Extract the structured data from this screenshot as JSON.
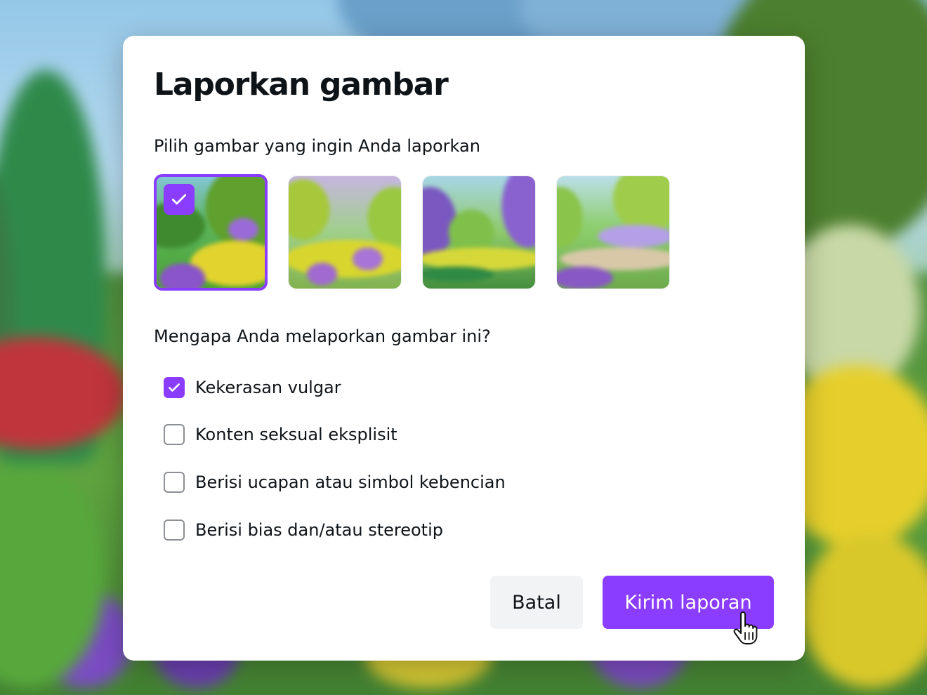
{
  "dialog": {
    "title": "Laporkan gambar",
    "image_prompt": "Pilih gambar yang ingin Anda laporkan",
    "reason_prompt": "Mengapa Anda melaporkan gambar ini?"
  },
  "images": [
    {
      "selected": true
    },
    {
      "selected": false
    },
    {
      "selected": false
    },
    {
      "selected": false
    }
  ],
  "reasons": [
    {
      "label": "Kekerasan vulgar",
      "checked": true
    },
    {
      "label": "Konten seksual eksplisit",
      "checked": false
    },
    {
      "label": "Berisi ucapan atau simbol kebencian",
      "checked": false
    },
    {
      "label": "Berisi bias dan/atau stereotip",
      "checked": false
    }
  ],
  "buttons": {
    "cancel_label": "Batal",
    "submit_label": "Kirim laporan"
  },
  "colors": {
    "accent": "#8b3dff",
    "cancel_bg": "#f2f3f5",
    "text": "#0e1318"
  },
  "icons": {
    "check": "check-icon",
    "cursor": "hand-pointer-icon"
  }
}
